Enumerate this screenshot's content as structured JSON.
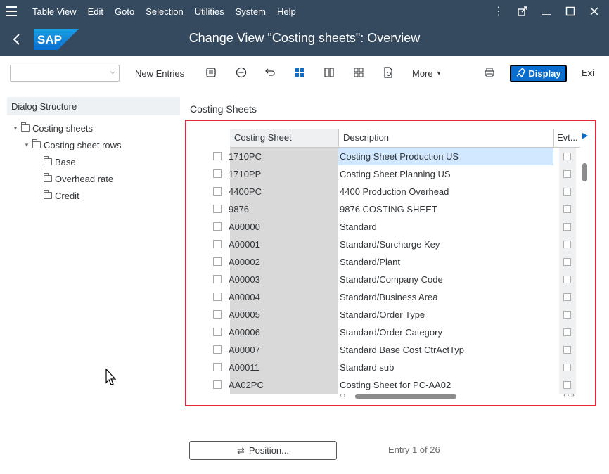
{
  "menubar": {
    "items": [
      "Table View",
      "Edit",
      "Goto",
      "Selection",
      "Utilities",
      "System",
      "Help"
    ]
  },
  "titlebar": {
    "title": "Change View \"Costing sheets\": Overview"
  },
  "toolbar": {
    "new_entries": "New Entries",
    "more": "More",
    "display": "Display",
    "exit": "Exi"
  },
  "dialog": {
    "header": "Dialog Structure",
    "tree": [
      {
        "label": "Costing sheets",
        "level": 0
      },
      {
        "label": "Costing sheet rows",
        "level": 1
      },
      {
        "label": "Base",
        "level": 2
      },
      {
        "label": "Overhead rate",
        "level": 2
      },
      {
        "label": "Credit",
        "level": 2
      }
    ]
  },
  "main": {
    "section_title": "Costing Sheets",
    "columns": [
      "Costing Sheet",
      "Description",
      "Evt..."
    ],
    "rows": [
      {
        "sheet": "1710PC",
        "desc": "Costing Sheet Production US"
      },
      {
        "sheet": "1710PP",
        "desc": "Costing Sheet Planning US"
      },
      {
        "sheet": "4400PC",
        "desc": "4400 Production Overhead"
      },
      {
        "sheet": "9876",
        "desc": "9876 COSTING SHEET"
      },
      {
        "sheet": "A00000",
        "desc": "Standard"
      },
      {
        "sheet": "A00001",
        "desc": "Standard/Surcharge Key"
      },
      {
        "sheet": "A00002",
        "desc": "Standard/Plant"
      },
      {
        "sheet": "A00003",
        "desc": "Standard/Company Code"
      },
      {
        "sheet": "A00004",
        "desc": "Standard/Business Area"
      },
      {
        "sheet": "A00005",
        "desc": "Standard/Order Type"
      },
      {
        "sheet": "A00006",
        "desc": "Standard/Order Category"
      },
      {
        "sheet": "A00007",
        "desc": "Standard Base Cost CtrActTyp"
      },
      {
        "sheet": "A00011",
        "desc": "Standard sub"
      },
      {
        "sheet": "AA02PC",
        "desc": "Costing Sheet for PC-AA02"
      }
    ]
  },
  "footer": {
    "position_label": "Position...",
    "entry_text": "Entry 1 of 26"
  }
}
